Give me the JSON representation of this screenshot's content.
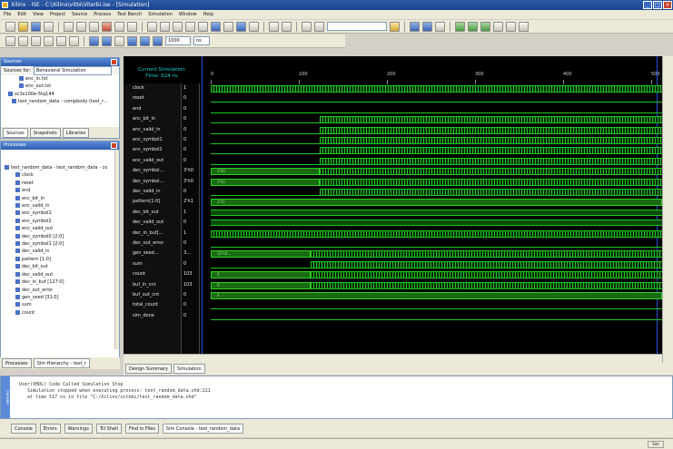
{
  "window": {
    "title": "Xilinx - ISE - C:\\Xilinx\\vitbi\\Viterbi.ise - [Simulation]",
    "buttons": [
      "_",
      "□",
      "×"
    ]
  },
  "menubar": [
    "File",
    "Edit",
    "View",
    "Project",
    "Source",
    "Process",
    "Test Bench",
    "Simulation",
    "Window",
    "Help"
  ],
  "toolbar2": {
    "time_value": "1000",
    "time_unit": "ns"
  },
  "sources_panel": {
    "title": "Sources",
    "label": "Sources for:",
    "select": "Behavioral Simulation",
    "tree": [
      "enc_in.txt",
      "enc_out.txt",
      "xc3s100e-5tq144",
      "test_random_data - compbody (test_r..."
    ],
    "tabs": [
      "Sources",
      "Snapshots",
      "Libraries"
    ]
  },
  "processes_panel": {
    "title": "Processes",
    "tree": [
      "test_random_data - test_random_data - co",
      "clock",
      "reset",
      "end",
      "enc_bit_in",
      "enc_valid_in",
      "enc_symbol1",
      "enc_symbol2",
      "enc_valid_out",
      "dec_symbol0 [2:0]",
      "dec_symbol1 [2:0]",
      "dec_valid_in",
      "pattern [1:0]",
      "dec_bit_out",
      "dec_valid_out",
      "dec_in_buf [127:0]",
      "dec_out_error",
      "gen_seed [31:0]",
      "sum",
      "count"
    ],
    "tabs": [
      "Processes",
      "Sim Hierarchy - test_r"
    ]
  },
  "wave": {
    "header": [
      "Current Simulation",
      "Time: 524 ns"
    ],
    "ticks": [
      "0",
      "100",
      "200",
      "300",
      "400",
      "500"
    ],
    "rows": [
      {
        "name": "clock",
        "value": "1"
      },
      {
        "name": "reset",
        "value": "0"
      },
      {
        "name": "end",
        "value": "0"
      },
      {
        "name": "enc_bit_in",
        "value": "0"
      },
      {
        "name": "enc_valid_in",
        "value": "0"
      },
      {
        "name": "enc_symbol1",
        "value": "0"
      },
      {
        "name": "enc_symbol2",
        "value": "0"
      },
      {
        "name": "enc_valid_out",
        "value": "0"
      },
      {
        "name": "dec_symbol...",
        "value": "3'h0"
      },
      {
        "name": "dec_symbol...",
        "value": "3'h0"
      },
      {
        "name": "dec_valid_in",
        "value": "0"
      },
      {
        "name": "pattern[1:0]",
        "value": "2'h1"
      },
      {
        "name": "dec_bit_out",
        "value": "1"
      },
      {
        "name": "dec_valid_out",
        "value": "0"
      },
      {
        "name": "dec_in_buf[...",
        "value": "1"
      },
      {
        "name": "dec_out_error",
        "value": "0"
      },
      {
        "name": "gen_seed...",
        "value": "3..."
      },
      {
        "name": "sum",
        "value": "0"
      },
      {
        "name": "count",
        "value": "103"
      },
      {
        "name": "buf_in_cnt",
        "value": "103"
      },
      {
        "name": "buf_out_cnt",
        "value": "0"
      },
      {
        "name": "total_count",
        "value": "0"
      },
      {
        "name": "sim_done",
        "value": "0"
      }
    ],
    "bus_labels": {
      "dec_sym": "3'h0",
      "pattern": "2'h1",
      "gen_seed": "32'h0...",
      "count": "0"
    },
    "tabs": [
      "Design Summary",
      "Simulation"
    ]
  },
  "console": {
    "lines": [
      "User(VHDL) Code Called Simulation Stop",
      "   Simulation stopped when executing process: test_random_data.vhd:221",
      "   at time 517 ns in file \"C:/Xilinx/vitebi/test_random_data.vhd\""
    ],
    "side_label": "Console"
  },
  "bottom_tabs": [
    "Console",
    "Errors",
    "Warnings",
    "Tcl Shell",
    "Find in Files",
    "Sim Console - test_random_data"
  ],
  "status": {
    "mode": "Sim"
  },
  "colors": {
    "wave_green": "#1ec81e",
    "cursor_blue": "#2a50e0",
    "title_blue": "#2c5ba8"
  }
}
